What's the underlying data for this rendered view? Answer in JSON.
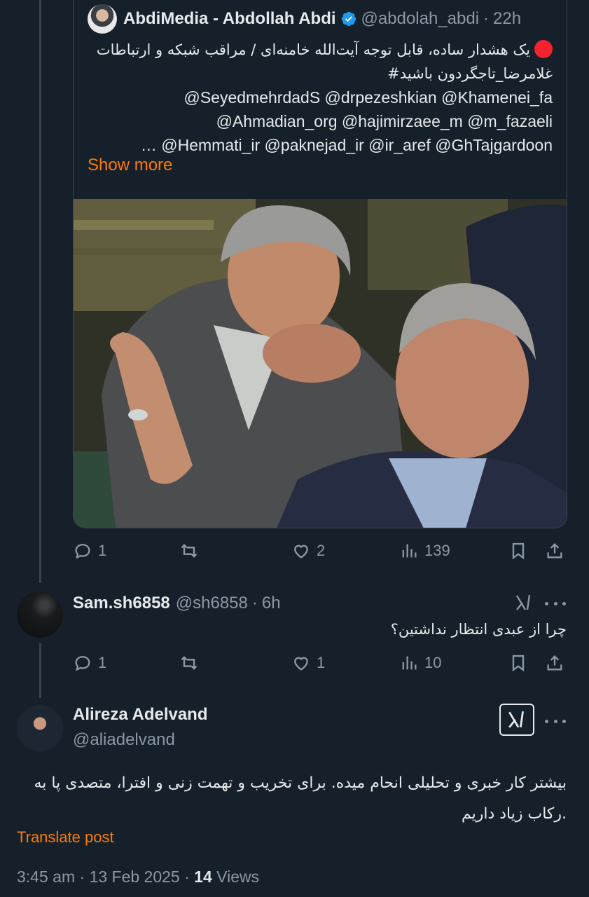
{
  "quoted_tweet": {
    "author_name": "AbdiMedia - Abdollah Abdi",
    "handle": "@abdolah_abdi",
    "separator": "·",
    "time": "22h",
    "text_lines": [
      "یک هشدار ساده، قابل توجه آیت‌الله خامنه‌ای / مراقب شبکه و ارتباطات",
      "#غلامرضا_تاجگردون باشید",
      "@SeyedmehrdadS @drpezeshkian @Khamenei_fa",
      "@Ahmadian_org @hajimirzaee_m @m_fazaeli",
      "… @Hemmati_ir @paknejad_ir @ir_aref @GhTajgardoon"
    ],
    "show_more_label": "Show more",
    "actions": {
      "replies": "1",
      "reposts": "",
      "likes": "2",
      "views": "139"
    },
    "icons": [
      "verified-badge-icon",
      "red-circle-emoji-icon"
    ]
  },
  "reply_tweet": {
    "author_name": "Sam.sh6858",
    "handle": "@sh6858",
    "separator": "·",
    "time": "6h",
    "text": "چرا از عبدی انتظار نداشتین؟",
    "actions": {
      "replies": "1",
      "reposts": "",
      "likes": "1",
      "views": "10"
    }
  },
  "main_tweet": {
    "author_name": "Alireza Adelvand",
    "handle": "@aliadelvand",
    "text_lines": [
      "بیشتر کار خبری و تحلیلی انحام میده. برای تخریب و تهمت زنی و افترا، متصدی پا به",
      "رکاب زیاد داریم."
    ],
    "translate_label": "Translate post",
    "time": "3:45 am",
    "date": "13 Feb 2025",
    "separator": "·",
    "views_count": "14",
    "views_label": "Views"
  },
  "colors": {
    "background": "#15202b",
    "text": "#e7e9ea",
    "muted": "#8b98a5",
    "accent": "#ff7a00",
    "verified": "#1d9bf0",
    "divider": "#38444d"
  }
}
